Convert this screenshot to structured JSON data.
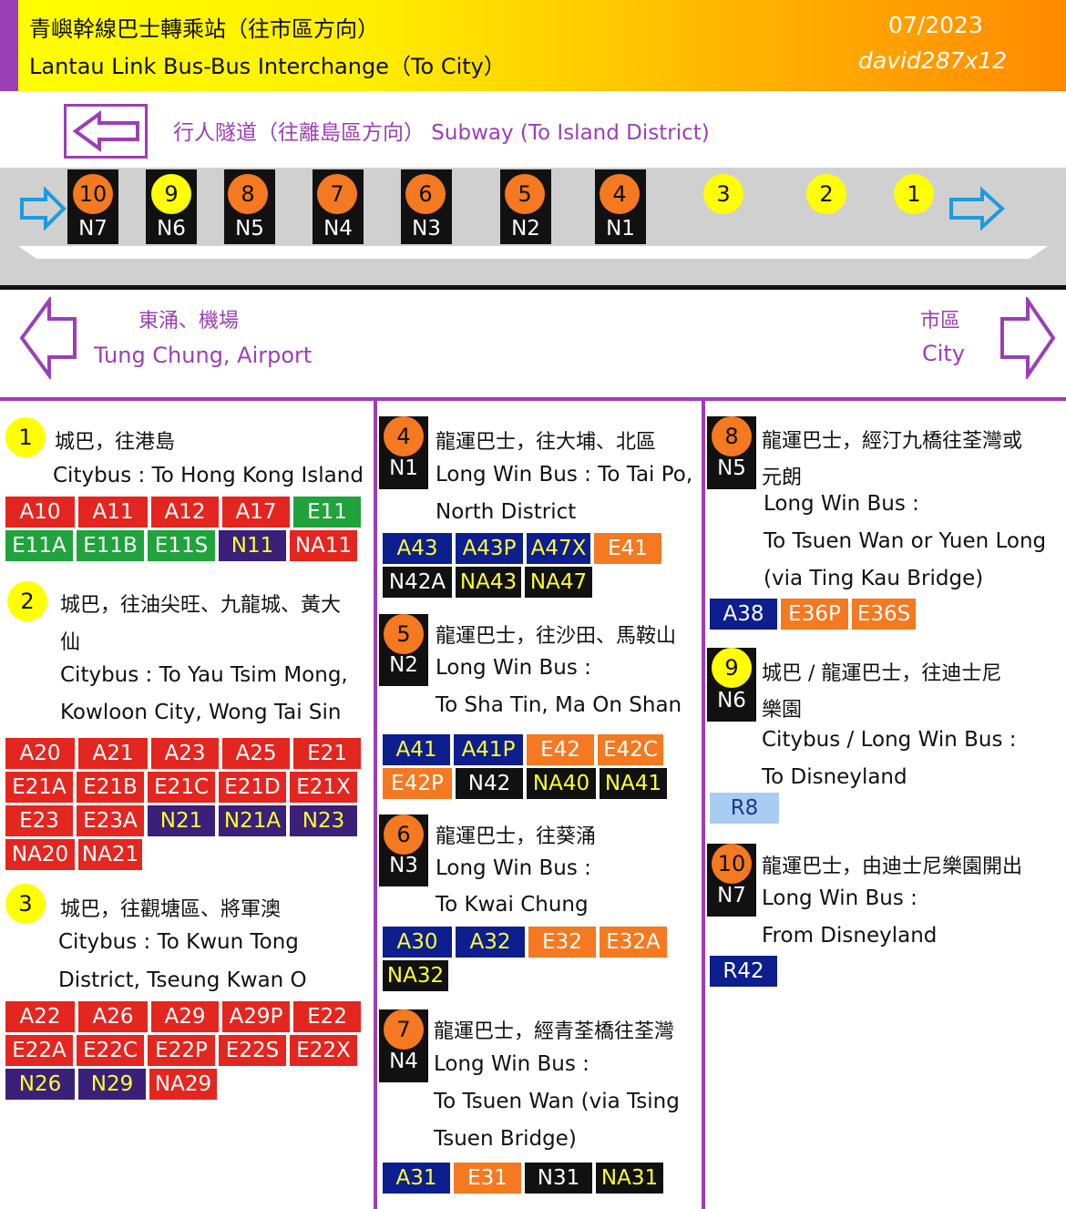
{
  "header": {
    "title_zh": "青嶼幹線巴士轉乘站（往市區方向）",
    "title_en": "Lantau Link Bus-Bus Interchange（To City）",
    "date": "07/2023",
    "author": "david287x12"
  },
  "subway": {
    "label": "行人隧道（往離島區方向）  Subway (To Island District)",
    "icon": "left-arrow-icon"
  },
  "bays": [
    {
      "num": "10",
      "code": "N7",
      "color": "orange"
    },
    {
      "num": "9",
      "code": "N6",
      "color": "yellow"
    },
    {
      "num": "8",
      "code": "N5",
      "color": "orange"
    },
    {
      "num": "7",
      "code": "N4",
      "color": "orange"
    },
    {
      "num": "6",
      "code": "N3",
      "color": "orange"
    },
    {
      "num": "5",
      "code": "N2",
      "color": "orange"
    },
    {
      "num": "4",
      "code": "N1",
      "color": "orange"
    },
    {
      "num": "3",
      "code": "",
      "color": "yellow"
    },
    {
      "num": "2",
      "code": "",
      "color": "yellow"
    },
    {
      "num": "1",
      "code": "",
      "color": "yellow"
    }
  ],
  "directions": {
    "left_zh": "東涌、機場",
    "left_en": "Tung Chung, Airport",
    "right_zh": "市區",
    "right_en": "City"
  },
  "stops": [
    {
      "num": "1",
      "code": "",
      "color": "yellow",
      "lines": [
        "城巴，往港島",
        "Citybus : To Hong Kong Island"
      ],
      "routes": [
        [
          [
            "A10",
            "red"
          ],
          [
            "A11",
            "red"
          ],
          [
            "A12",
            "red"
          ],
          [
            "A17",
            "red"
          ],
          [
            "E11",
            "green"
          ]
        ],
        [
          [
            "E11A",
            "green"
          ],
          [
            "E11B",
            "green"
          ],
          [
            "E11S",
            "green"
          ],
          [
            "N11",
            "purple"
          ],
          [
            "NA11",
            "red"
          ]
        ]
      ]
    },
    {
      "num": "2",
      "code": "",
      "color": "yellow",
      "lines": [
        "城巴，往油尖旺、九龍城、黃大",
        "仙",
        "Citybus : To Yau Tsim Mong,",
        "Kowloon City, Wong Tai Sin"
      ],
      "routes": [
        [
          [
            "A20",
            "red"
          ],
          [
            "A21",
            "red"
          ],
          [
            "A23",
            "red"
          ],
          [
            "A25",
            "red"
          ],
          [
            "E21",
            "red"
          ]
        ],
        [
          [
            "E21A",
            "red"
          ],
          [
            "E21B",
            "red"
          ],
          [
            "E21C",
            "red"
          ],
          [
            "E21D",
            "red"
          ],
          [
            "E21X",
            "red"
          ]
        ],
        [
          [
            "E23",
            "red"
          ],
          [
            "E23A",
            "red"
          ],
          [
            "N21",
            "purple"
          ],
          [
            "N21A",
            "purple"
          ],
          [
            "N23",
            "purple"
          ]
        ],
        [
          [
            "NA20",
            "red"
          ],
          [
            "NA21",
            "red"
          ]
        ]
      ]
    },
    {
      "num": "3",
      "code": "",
      "color": "yellow",
      "lines": [
        "城巴，往觀塘區、將軍澳",
        "Citybus : To Kwun Tong",
        "District, Tseung Kwan O"
      ],
      "routes": [
        [
          [
            "A22",
            "red"
          ],
          [
            "A26",
            "red"
          ],
          [
            "A29",
            "red"
          ],
          [
            "A29P",
            "red"
          ],
          [
            "E22",
            "red"
          ]
        ],
        [
          [
            "E22A",
            "red"
          ],
          [
            "E22C",
            "red"
          ],
          [
            "E22P",
            "red"
          ],
          [
            "E22S",
            "red"
          ],
          [
            "E22X",
            "red"
          ]
        ],
        [
          [
            "N26",
            "purple"
          ],
          [
            "N29",
            "purple"
          ],
          [
            "NA29",
            "red"
          ]
        ]
      ]
    },
    {
      "num": "4",
      "code": "N1",
      "color": "orange",
      "lines": [
        "龍運巴士，往大埔、北區",
        "Long Win Bus : To Tai Po,",
        "North District"
      ],
      "routes": [
        [
          [
            "A43",
            "navy"
          ],
          [
            "A43P",
            "navy"
          ],
          [
            "A47X",
            "navy"
          ],
          [
            "E41",
            "orange"
          ]
        ],
        [
          [
            "N42A",
            "black"
          ],
          [
            "NA43",
            "blacky"
          ],
          [
            "NA47",
            "blacky"
          ]
        ]
      ]
    },
    {
      "num": "5",
      "code": "N2",
      "color": "orange",
      "lines": [
        "龍運巴士，往沙田、馬鞍山",
        "Long Win Bus :",
        "To Sha Tin, Ma On Shan"
      ],
      "routes": [
        [
          [
            "A41",
            "navy"
          ],
          [
            "A41P",
            "navy"
          ],
          [
            "E42",
            "orange"
          ],
          [
            "E42C",
            "orange"
          ]
        ],
        [
          [
            "E42P",
            "orange"
          ],
          [
            "N42",
            "black"
          ],
          [
            "NA40",
            "blacky"
          ],
          [
            "NA41",
            "blacky"
          ]
        ]
      ]
    },
    {
      "num": "6",
      "code": "N3",
      "color": "orange",
      "lines": [
        "龍運巴士，往葵涌",
        "Long Win Bus :",
        "To Kwai Chung"
      ],
      "routes": [
        [
          [
            "A30",
            "navy"
          ],
          [
            "A32",
            "navy"
          ],
          [
            "E32",
            "orange"
          ],
          [
            "E32A",
            "orange"
          ]
        ],
        [
          [
            "NA32",
            "blacky"
          ]
        ]
      ]
    },
    {
      "num": "7",
      "code": "N4",
      "color": "orange",
      "lines": [
        "龍運巴士，經青荃橋往荃灣",
        "Long Win Bus :",
        "To Tsuen Wan (via Tsing",
        "Tsuen Bridge)"
      ],
      "routes": [
        [
          [
            "A31",
            "navy"
          ],
          [
            "E31",
            "orange"
          ],
          [
            "N31",
            "black"
          ],
          [
            "NA31",
            "blacky"
          ]
        ]
      ]
    },
    {
      "num": "8",
      "code": "N5",
      "color": "orange",
      "lines": [
        "龍運巴士，經汀九橋往荃灣或",
        "元朗",
        "Long Win Bus :",
        "To Tsuen Wan or Yuen Long",
        "(via Ting Kau Bridge)"
      ],
      "routes": [
        [
          [
            "A38",
            "blue"
          ],
          [
            "E36P",
            "orange"
          ],
          [
            "E36S",
            "orange"
          ]
        ]
      ]
    },
    {
      "num": "9",
      "code": "N6",
      "color": "yellow",
      "lines": [
        "城巴 / 龍運巴士，往迪士尼",
        "樂園",
        "Citybus / Long Win Bus :",
        "To Disneyland"
      ],
      "routes": [
        [
          [
            "R8",
            "light"
          ]
        ]
      ]
    },
    {
      "num": "10",
      "code": "N7",
      "color": "orange",
      "lines": [
        "龍運巴士，由迪士尼樂園開出",
        "Long Win Bus :",
        "From Disneyland"
      ],
      "routes": [
        [
          [
            "R42",
            "blue"
          ]
        ]
      ]
    }
  ]
}
